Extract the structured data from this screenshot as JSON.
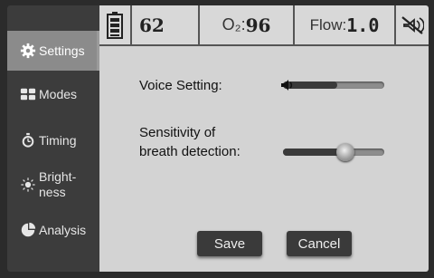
{
  "status": {
    "battery_icon": "battery-icon",
    "value": "62",
    "o2_label": "O₂:",
    "o2_value": "96",
    "flow_label": "Flow:",
    "flow_value": "1.0",
    "mute_icon": "mute-alarm-icon"
  },
  "sidebar": {
    "items": [
      {
        "label": "Settings",
        "icon": "gear-icon",
        "active": true
      },
      {
        "label": "Modes",
        "icon": "grid-icon"
      },
      {
        "label": "Timing",
        "icon": "stopwatch-icon"
      },
      {
        "label": "Bright-",
        "label2": "ness",
        "icon": "sun-icon"
      },
      {
        "label": "Analysis",
        "icon": "pie-chart-icon"
      }
    ]
  },
  "settings": {
    "voice_label": "Voice Setting:",
    "voice_icon": "speaker-icon",
    "voice_level": 0.0,
    "sensitivity_label_line1": "Sensitivity of",
    "sensitivity_label_line2": "breath detection:",
    "sensitivity_level": 0.62
  },
  "buttons": {
    "save": "Save",
    "cancel": "Cancel"
  },
  "colors": {
    "panel": "#d3d3d3",
    "sidebar": "#3c3c3c",
    "active_tab": "#8b8b8b",
    "button": "#3a3a3a"
  }
}
